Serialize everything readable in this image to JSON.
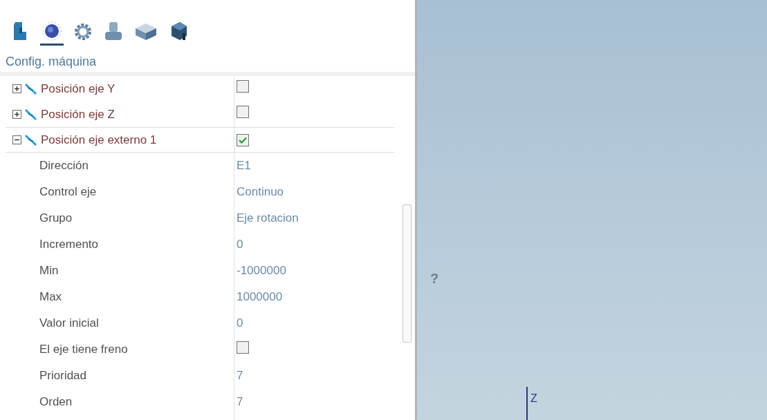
{
  "toolbar": {
    "tabs": [
      {
        "kind": "machine",
        "selected": false
      },
      {
        "kind": "knob",
        "selected": true
      },
      {
        "kind": "gear",
        "selected": false
      },
      {
        "kind": "part",
        "selected": false
      },
      {
        "kind": "block",
        "selected": false
      },
      {
        "kind": "tool",
        "selected": false
      }
    ]
  },
  "panel_title": "Config. máquina",
  "tree": [
    {
      "label": "Posición eje Y",
      "checked": false,
      "expanded": false
    },
    {
      "label": "Posición eje Z",
      "checked": false,
      "expanded": false
    },
    {
      "label": "Posición eje externo 1",
      "checked": true,
      "expanded": true,
      "children": [
        {
          "kind": "text",
          "label": "Dirección",
          "value": "E1"
        },
        {
          "kind": "text",
          "label": "Control eje",
          "value": "Continuo"
        },
        {
          "kind": "text",
          "label": "Grupo",
          "value": "Eje rotacion"
        },
        {
          "kind": "text",
          "label": "Incremento",
          "value": "0"
        },
        {
          "kind": "text",
          "label": "Min",
          "value": "-1000000"
        },
        {
          "kind": "text",
          "label": "Max",
          "value": "1000000"
        },
        {
          "kind": "text",
          "label": "Valor inicial",
          "value": "0"
        },
        {
          "kind": "checkbox",
          "label": "El eje tiene freno",
          "checked": false
        },
        {
          "kind": "text",
          "label": "Prioridad",
          "value": "7"
        },
        {
          "kind": "text",
          "label": "Orden",
          "value": "7"
        }
      ]
    }
  ],
  "viewport": {
    "help_mark": "?",
    "axis_label": "Z"
  }
}
